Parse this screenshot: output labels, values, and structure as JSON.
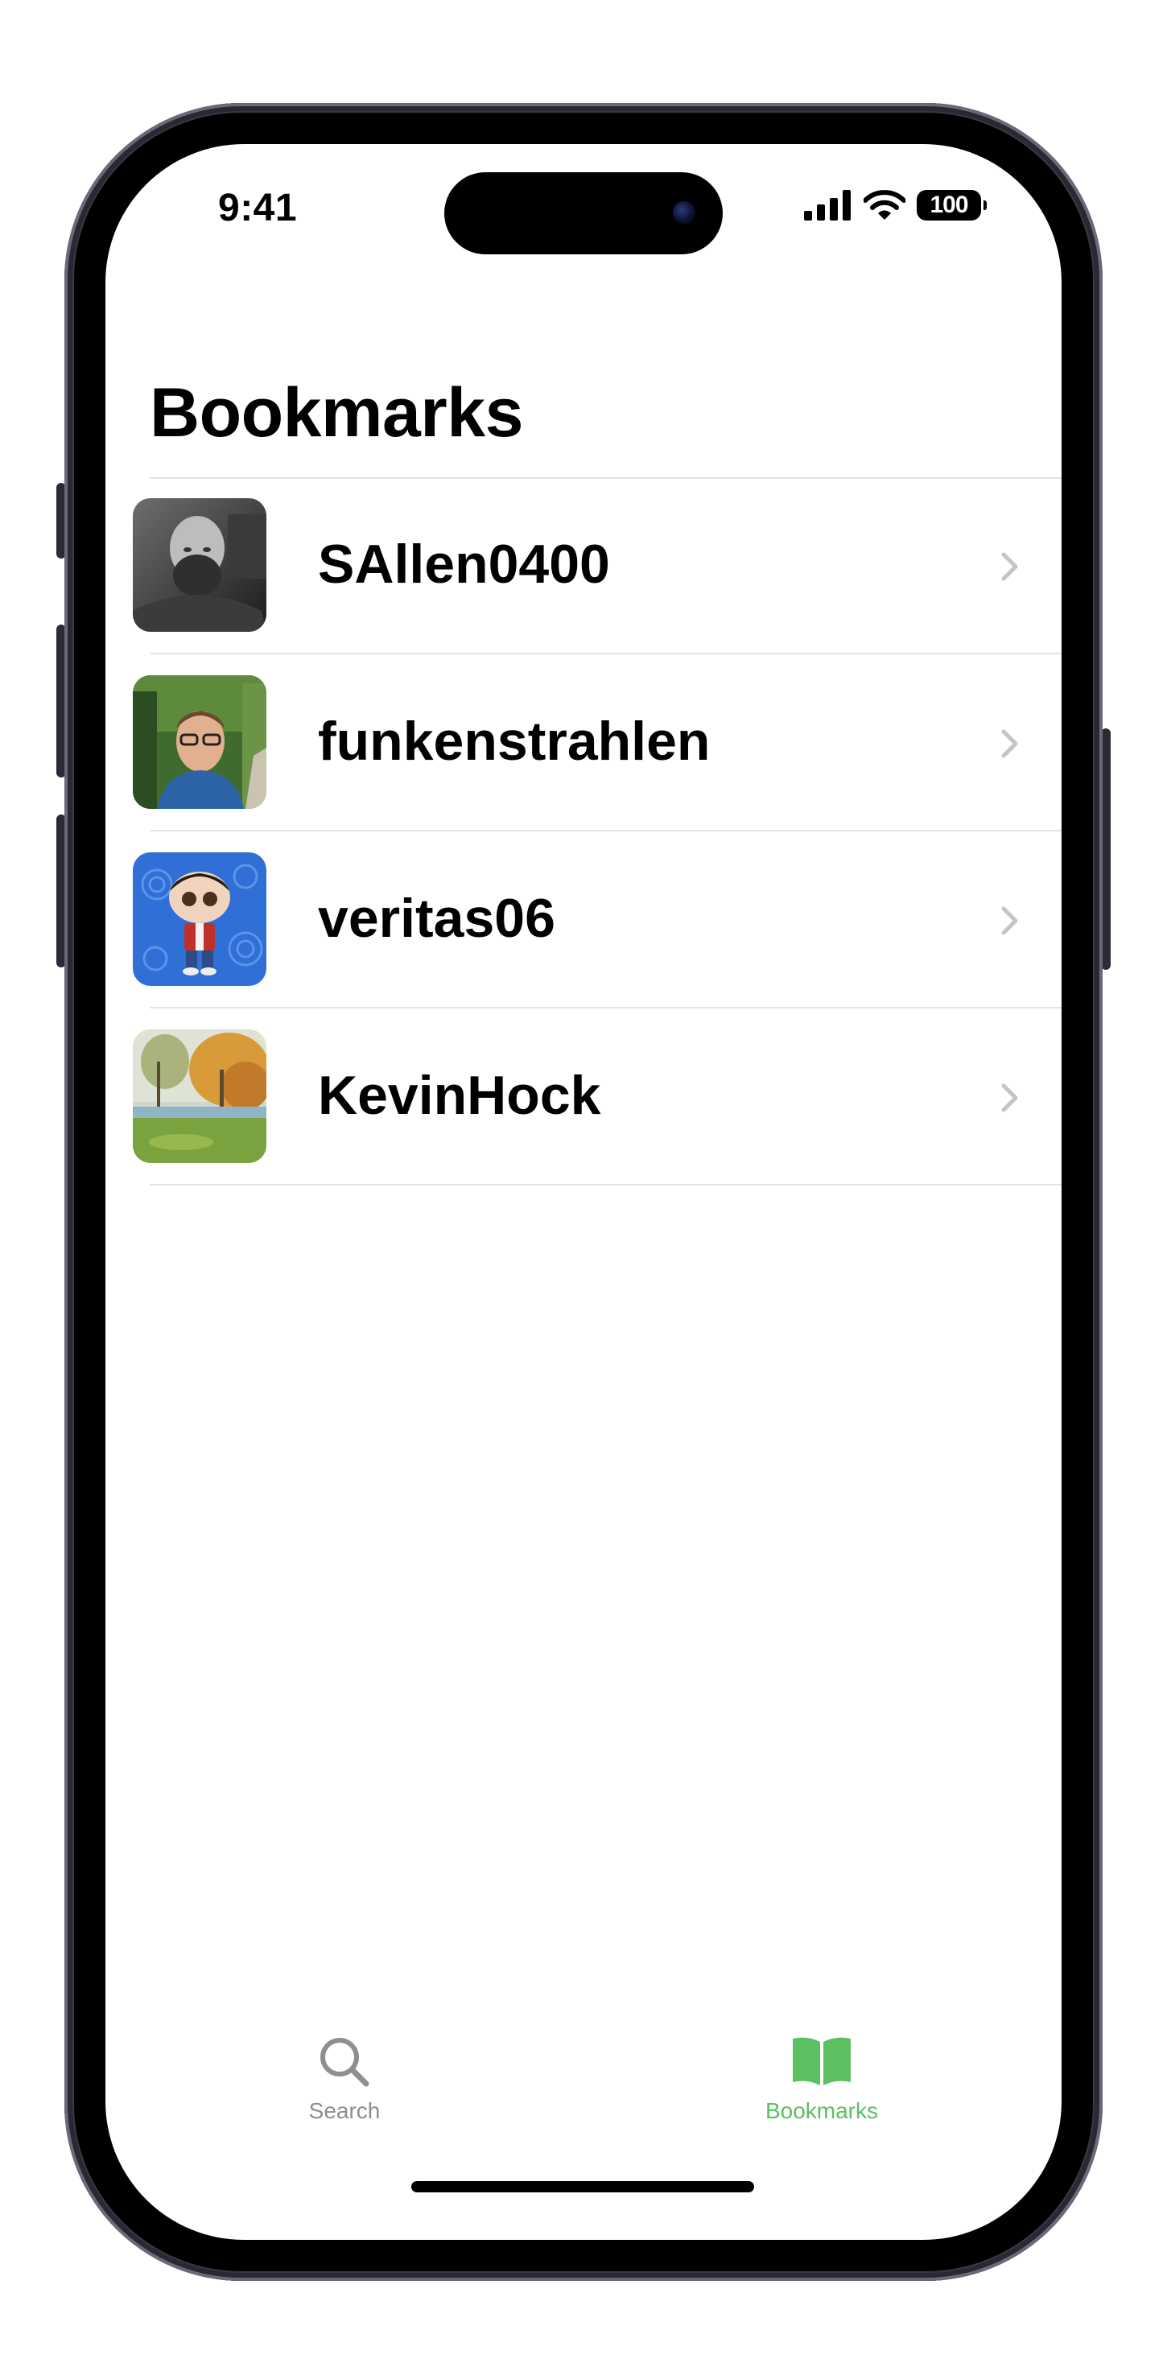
{
  "status_bar": {
    "time": "9:41",
    "battery": "100"
  },
  "page": {
    "title": "Bookmarks"
  },
  "bookmarks": [
    {
      "username": "SAllen0400",
      "avatar": "photo-bald-bearded-man"
    },
    {
      "username": "funkenstrahlen",
      "avatar": "photo-man-glasses-forest"
    },
    {
      "username": "veritas06",
      "avatar": "cartoon-figure-blue-background"
    },
    {
      "username": "KevinHock",
      "avatar": "painting-autumn-landscape"
    }
  ],
  "tab_bar": {
    "items": [
      {
        "label": "Search",
        "icon": "magnifying-glass-icon",
        "selected": false
      },
      {
        "label": "Bookmarks",
        "icon": "open-book-icon",
        "selected": true
      }
    ]
  },
  "colors": {
    "accent": "#5cbf61",
    "inactive_tab": "#8e8e93",
    "chevron": "#c4c4c7",
    "divider": "#e3e3e6"
  }
}
